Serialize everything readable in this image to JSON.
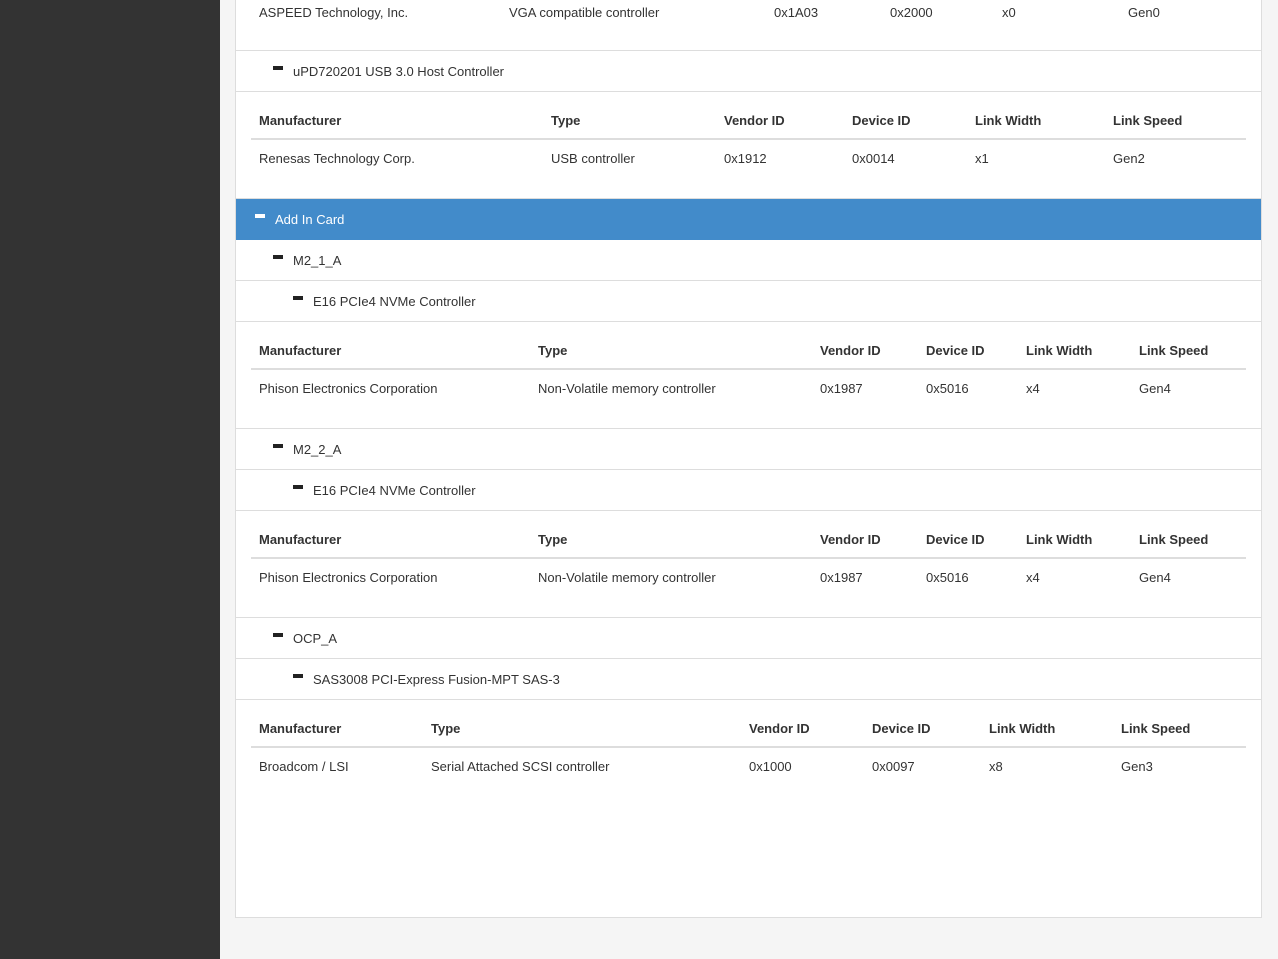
{
  "top_partial_row": [
    "ASPEED Technology, Inc.",
    "VGA compatible controller",
    "0x1A03",
    "0x2000",
    "x0",
    "Gen0"
  ],
  "usb_device": {
    "label": "uPD720201 USB 3.0 Host Controller",
    "headers": [
      "Manufacturer",
      "Type",
      "Vendor ID",
      "Device ID",
      "Link Width",
      "Link Speed"
    ],
    "row": [
      "Renesas Technology Corp.",
      "USB controller",
      "0x1912",
      "0x0014",
      "x1",
      "Gen2"
    ]
  },
  "add_in_card": {
    "label": "Add In Card",
    "slots": [
      {
        "label": "M2_1_A",
        "device": "E16 PCIe4 NVMe Controller",
        "headers": [
          "Manufacturer",
          "Type",
          "Vendor ID",
          "Device ID",
          "Link Width",
          "Link Speed"
        ],
        "row": [
          "Phison Electronics Corporation",
          "Non-Volatile memory controller",
          "0x1987",
          "0x5016",
          "x4",
          "Gen4"
        ]
      },
      {
        "label": "M2_2_A",
        "device": "E16 PCIe4 NVMe Controller",
        "headers": [
          "Manufacturer",
          "Type",
          "Vendor ID",
          "Device ID",
          "Link Width",
          "Link Speed"
        ],
        "row": [
          "Phison Electronics Corporation",
          "Non-Volatile memory controller",
          "0x1987",
          "0x5016",
          "x4",
          "Gen4"
        ]
      },
      {
        "label": "OCP_A",
        "device": "SAS3008 PCI-Express Fusion-MPT SAS-3",
        "headers": [
          "Manufacturer",
          "Type",
          "Vendor ID",
          "Device ID",
          "Link Width",
          "Link Speed"
        ],
        "row": [
          "Broadcom / LSI",
          "Serial Attached SCSI controller",
          "0x1000",
          "0x0097",
          "x8",
          "Gen3"
        ]
      }
    ]
  },
  "colors": {
    "sidebar": "#333333",
    "category_header": "#428bca",
    "page_background": "#f5f5f5"
  }
}
